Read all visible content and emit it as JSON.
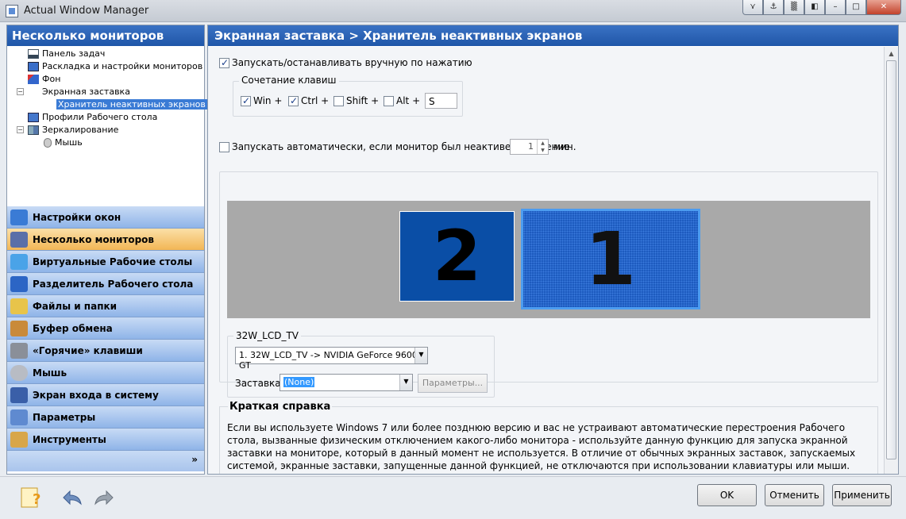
{
  "window": {
    "title": "Actual Window Manager",
    "title_buttons": [
      "⋎",
      "⚓",
      "▒",
      "◧",
      "–",
      "□",
      "✕"
    ]
  },
  "left": {
    "header": "Несколько мониторов",
    "tree": [
      {
        "label": "Панель задач"
      },
      {
        "label": "Раскладка и настройки мониторов"
      },
      {
        "label": "Фон"
      },
      {
        "label": "Экранная заставка"
      },
      {
        "label": "Хранитель неактивных экранов",
        "selected": true
      },
      {
        "label": "Профили Рабочего стола"
      },
      {
        "label": "Зеркалирование"
      },
      {
        "label": "Мышь"
      }
    ],
    "nav": [
      {
        "label": "Настройки окон",
        "color": "#3a7bd5"
      },
      {
        "label": "Несколько мониторов",
        "color": "#5a6fa8",
        "active": true
      },
      {
        "label": "Виртуальные Рабочие столы",
        "color": "#4aa3e8"
      },
      {
        "label": "Разделитель Рабочего стола",
        "color": "#2c65c5"
      },
      {
        "label": "Файлы и папки",
        "color": "#e8c44a"
      },
      {
        "label": "Буфер обмена",
        "color": "#c98a3a"
      },
      {
        "label": "«Горячие» клавиши",
        "color": "#8a8f99"
      },
      {
        "label": "Мышь",
        "color": "#b8bcc4"
      },
      {
        "label": "Экран входа в систему",
        "color": "#3a5fa8"
      },
      {
        "label": "Параметры",
        "color": "#5f8ad0"
      },
      {
        "label": "Инструменты",
        "color": "#d8a64a"
      }
    ],
    "nav_more": "»"
  },
  "right": {
    "header": "Экранная заставка > Хранитель неактивных экранов",
    "manual_check_label": "Запускать/останавливать вручную по нажатию",
    "hotkey_group": "Сочетание клавиш",
    "hotkeys": {
      "win": {
        "label": "Win +",
        "checked": true
      },
      "ctrl": {
        "label": "Ctrl +",
        "checked": true
      },
      "shift": {
        "label": "Shift +",
        "checked": false
      },
      "alt": {
        "label": "Alt +",
        "checked": false
      },
      "key": "S"
    },
    "auto_label": "Запускать автоматически, если монитор был неактивен в течение",
    "auto_value": "1",
    "auto_unit": "мин.",
    "monitors": [
      {
        "label": "2"
      },
      {
        "label": "1",
        "selected": true
      }
    ],
    "monitor_group": "32W_LCD_TV",
    "monitor_select": "1. 32W_LCD_TV -> NVIDIA GeForce 9600 GT",
    "saver_label": "Заставка:",
    "saver_value": "(None)",
    "params_button": "Параметры...",
    "help_title": "Краткая справка",
    "help_text": "Если вы используете Windows 7 или более позднюю версию и вас не устраивают автоматические перестроения Рабочего стола, вызванные физическим отключением какого-либо монитора - используйте данную функцию для запуска экранной заставки на мониторе, который в данный момент не используется. В отличие от обычных экранных заставок, запускаемых системой, экранные заставки, запущенные данной функцией, не отключаются при использовании клавиатуры или мыши. Запуск возможен как"
  },
  "buttons": {
    "ok": "OK",
    "cancel": "Отменить",
    "apply": "Применить"
  }
}
